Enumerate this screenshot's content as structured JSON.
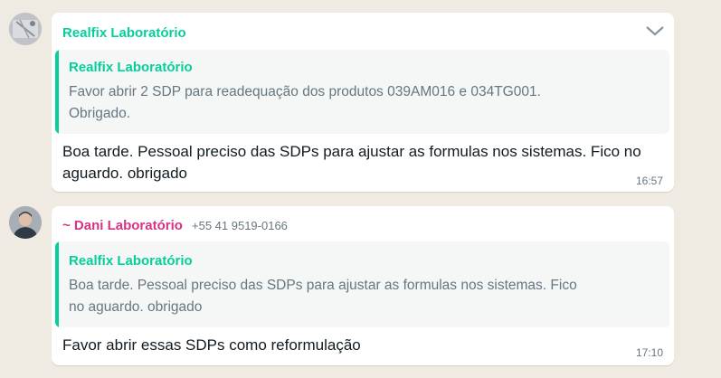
{
  "colors": {
    "background": "#efeae2",
    "bubble": "#ffffff",
    "quote_background": "#f5f6f6",
    "realfix_green": "#06cf9c",
    "dani_pink": "#d63384",
    "meta_gray": "#667781",
    "text": "#111b21"
  },
  "messages": [
    {
      "sender": "Realfix Laboratório",
      "avatar_icon": "group-photo-icon",
      "menu_icon": "chevron-down-icon",
      "quote": {
        "author": "Realfix Laboratório",
        "text": "Favor abrir 2 SDP para readequação dos produtos 039AM016 e 034TG001.\nObrigado."
      },
      "text": "Boa tarde. Pessoal preciso das SDPs para ajustar as formulas nos sistemas. Fico no\naguardo. obrigado",
      "time": "16:57"
    },
    {
      "sender": "~ Dani Laboratório",
      "phone": "+55 41 9519-0166",
      "avatar_icon": "user-photo-icon",
      "quote": {
        "author": "Realfix Laboratório",
        "text": "Boa tarde. Pessoal preciso das SDPs para ajustar as formulas nos sistemas. Fico\nno aguardo. obrigado"
      },
      "text": "Favor abrir essas SDPs como reformulação",
      "time": "17:10"
    }
  ]
}
